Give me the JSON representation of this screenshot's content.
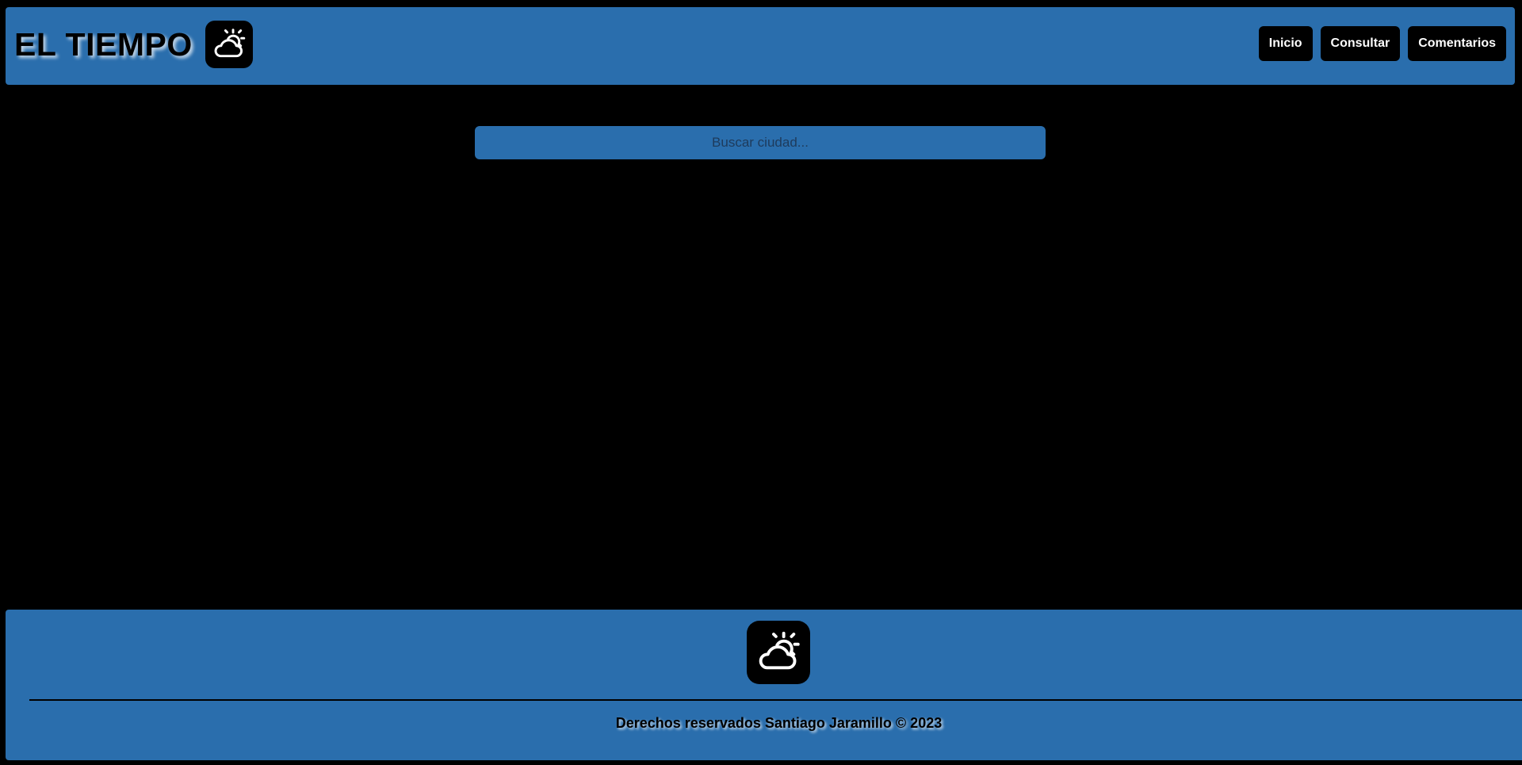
{
  "header": {
    "title": "EL TIEMPO",
    "logo_icon": "cloud-sun-icon",
    "nav": [
      {
        "label": "Inicio"
      },
      {
        "label": "Consultar"
      },
      {
        "label": "Comentarios"
      }
    ]
  },
  "search": {
    "placeholder": "Buscar ciudad...",
    "value": ""
  },
  "footer": {
    "logo_icon": "cloud-sun-icon",
    "copyright": "Derechos reservados Santiago Jaramillo © 2023"
  },
  "colors": {
    "background": "#000000",
    "accent": "#2a6ead",
    "button": "#000000",
    "button_text": "#ffffff"
  }
}
